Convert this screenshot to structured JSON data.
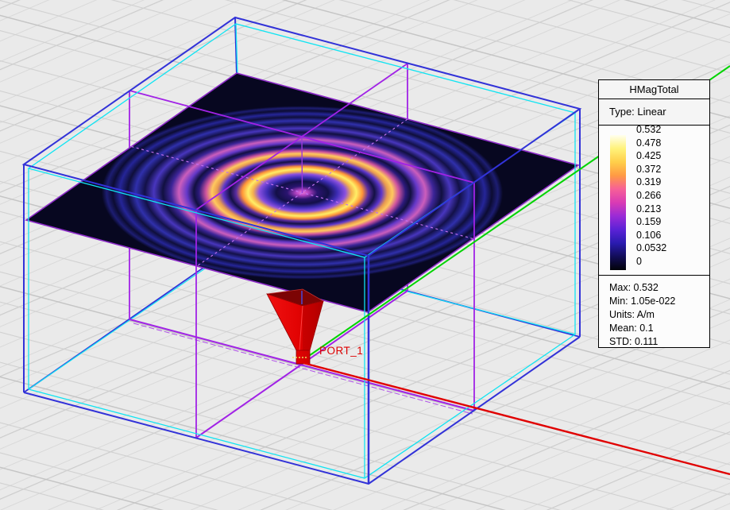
{
  "scene": {
    "port_label": "PORT_1"
  },
  "legend": {
    "title": "HMagTotal",
    "type_label": "Type: Linear",
    "ticks": [
      "0.532",
      "0.478",
      "0.425",
      "0.372",
      "0.319",
      "0.266",
      "0.213",
      "0.159",
      "0.106",
      "0.0532",
      "0"
    ],
    "stats": {
      "max": "Max: 0.532",
      "min": "Min: 1.05e-022",
      "units": "Units: A/m",
      "mean": "Mean: 0.1",
      "std": "STD: 0.111"
    }
  },
  "colors": {
    "background": "#eaeaea",
    "outer_box_blue": "#3232d8",
    "inner_box_cyan": "#10e4f2",
    "midplane_violet": "#a122e6",
    "axis_x_red": "#e00000",
    "axis_y_green": "#00d400",
    "antenna_red": "#e00000",
    "colormap_top": "#ffffee",
    "colormap_bottom": "#020208"
  }
}
